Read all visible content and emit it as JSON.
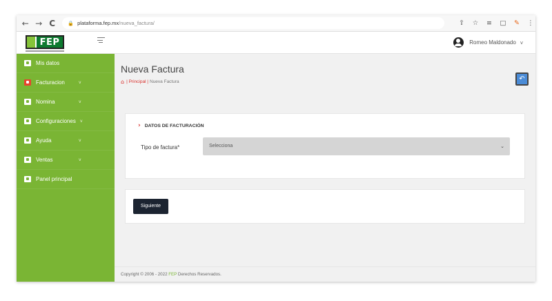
{
  "browser": {
    "url_domain": "plataforma.fep.mx",
    "url_path": "/nueva_factura/",
    "back_glyph": "←",
    "forward_glyph": "→",
    "reload_glyph": "C",
    "lock_glyph": "🔒",
    "share_glyph": "⇪",
    "star_glyph": "☆",
    "queue_glyph": "≡",
    "window_glyph": "□",
    "extension_glyph": "✎",
    "menu_glyph": "⋮"
  },
  "header": {
    "logo_text": "FEP",
    "user_name": "Romeo Maldonado",
    "user_caret": "v"
  },
  "sidebar": {
    "items": [
      {
        "label": "Mis datos",
        "icon": "user-icon",
        "caret": ""
      },
      {
        "label": "Facturacion",
        "icon": "invoice-icon",
        "caret": "v"
      },
      {
        "label": "Nomina",
        "icon": "payroll-icon",
        "caret": "v"
      },
      {
        "label": "Configuraciones",
        "icon": "settings-icon",
        "caret": "v"
      },
      {
        "label": "Ayuda",
        "icon": "help-icon",
        "caret": "v"
      },
      {
        "label": "Ventas",
        "icon": "sales-icon",
        "caret": "v"
      },
      {
        "label": "Panel principal",
        "icon": "dashboard-icon",
        "caret": ""
      }
    ]
  },
  "main": {
    "title": "Nueva Factura",
    "breadcrumb_home_icon": "⌂",
    "breadcrumb_link": "| Principal |",
    "breadcrumb_current": "Nueva Factura",
    "back_glyph": "↶",
    "section_chevron": "›",
    "section_title": "DATOS DE FACTURACIÓN",
    "field_label": "Tipo de factura*",
    "select_value": "Selecciona",
    "select_caret": "⌄",
    "next_button": "Siguiente"
  },
  "footer": {
    "text_before": "Copyright © 2006 - 2022",
    "brand": "FEP",
    "text_after": "Derechos Reservados."
  },
  "colors": {
    "sidebar_green": "#7ab534",
    "accent_red": "#d9302c",
    "dark_button": "#1c2431",
    "back_button_blue": "#4a8bd6"
  }
}
